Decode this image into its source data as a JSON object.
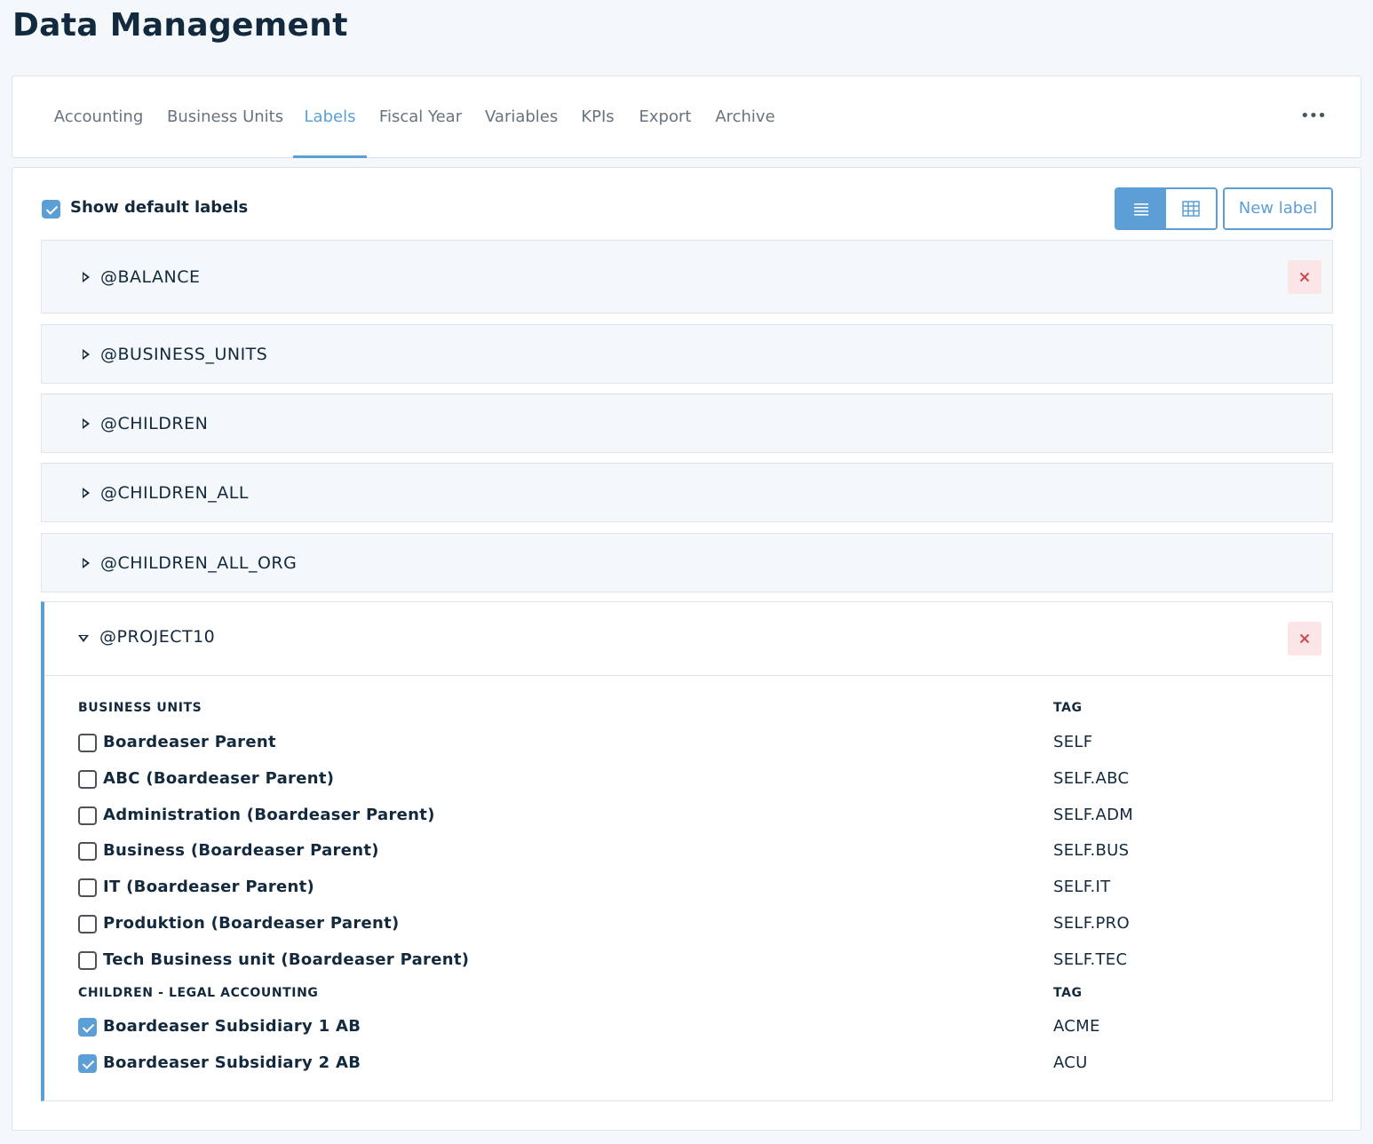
{
  "page": {
    "title": "Data Management"
  },
  "tabs": [
    {
      "label": "Accounting"
    },
    {
      "label": "Business Units"
    },
    {
      "label": "Labels",
      "active": true
    },
    {
      "label": "Fiscal Year"
    },
    {
      "label": "Variables"
    },
    {
      "label": "KPIs"
    },
    {
      "label": "Export"
    },
    {
      "label": "Archive"
    }
  ],
  "more_menu": {
    "icon": "more-horizontal-icon",
    "glyph": "•••"
  },
  "toolbar": {
    "show_default_labels": {
      "label": "Show default labels",
      "checked": true
    },
    "view_toggle": {
      "list_icon": "list-view-icon",
      "grid_icon": "table-view-icon",
      "active": "list"
    },
    "new_label_button": "New label"
  },
  "labels": [
    {
      "name": "@BALANCE",
      "deletable": true,
      "expanded": false
    },
    {
      "name": "@BUSINESS_UNITS",
      "deletable": false,
      "expanded": false
    },
    {
      "name": "@CHILDREN",
      "deletable": false,
      "expanded": false
    },
    {
      "name": "@CHILDREN_ALL",
      "deletable": false,
      "expanded": false
    },
    {
      "name": "@CHILDREN_ALL_ORG",
      "deletable": false,
      "expanded": false
    }
  ],
  "expanded_label": {
    "name": "@PROJECT10",
    "deletable": true,
    "sections": [
      {
        "header": "BUSINESS UNITS",
        "tag_header": "TAG",
        "items": [
          {
            "name": "Boardeaser Parent",
            "tag": "SELF",
            "checked": false
          },
          {
            "name": "ABC (Boardeaser Parent)",
            "tag": "SELF.ABC",
            "checked": false
          },
          {
            "name": "Administration (Boardeaser Parent)",
            "tag": "SELF.ADM",
            "checked": false
          },
          {
            "name": "Business (Boardeaser Parent)",
            "tag": "SELF.BUS",
            "checked": false
          },
          {
            "name": "IT (Boardeaser Parent)",
            "tag": "SELF.IT",
            "checked": false
          },
          {
            "name": "Produktion (Boardeaser Parent)",
            "tag": "SELF.PRO",
            "checked": false
          },
          {
            "name": "Tech Business unit (Boardeaser Parent)",
            "tag": "SELF.TEC",
            "checked": false
          }
        ]
      },
      {
        "header": "CHILDREN - LEGAL ACCOUNTING",
        "tag_header": "TAG",
        "items": [
          {
            "name": "Boardeaser Subsidiary 1 AB",
            "tag": "ACME",
            "checked": true
          },
          {
            "name": "Boardeaser Subsidiary 2 AB",
            "tag": "ACU",
            "checked": true
          }
        ]
      }
    ]
  },
  "colors": {
    "accent": "#5c9fd6",
    "text": "#13293d",
    "muted_tab": "#67737d",
    "row_bg": "#f4f8fb",
    "delete_bg": "#fbe5e6",
    "delete_icon": "#d04a52"
  }
}
